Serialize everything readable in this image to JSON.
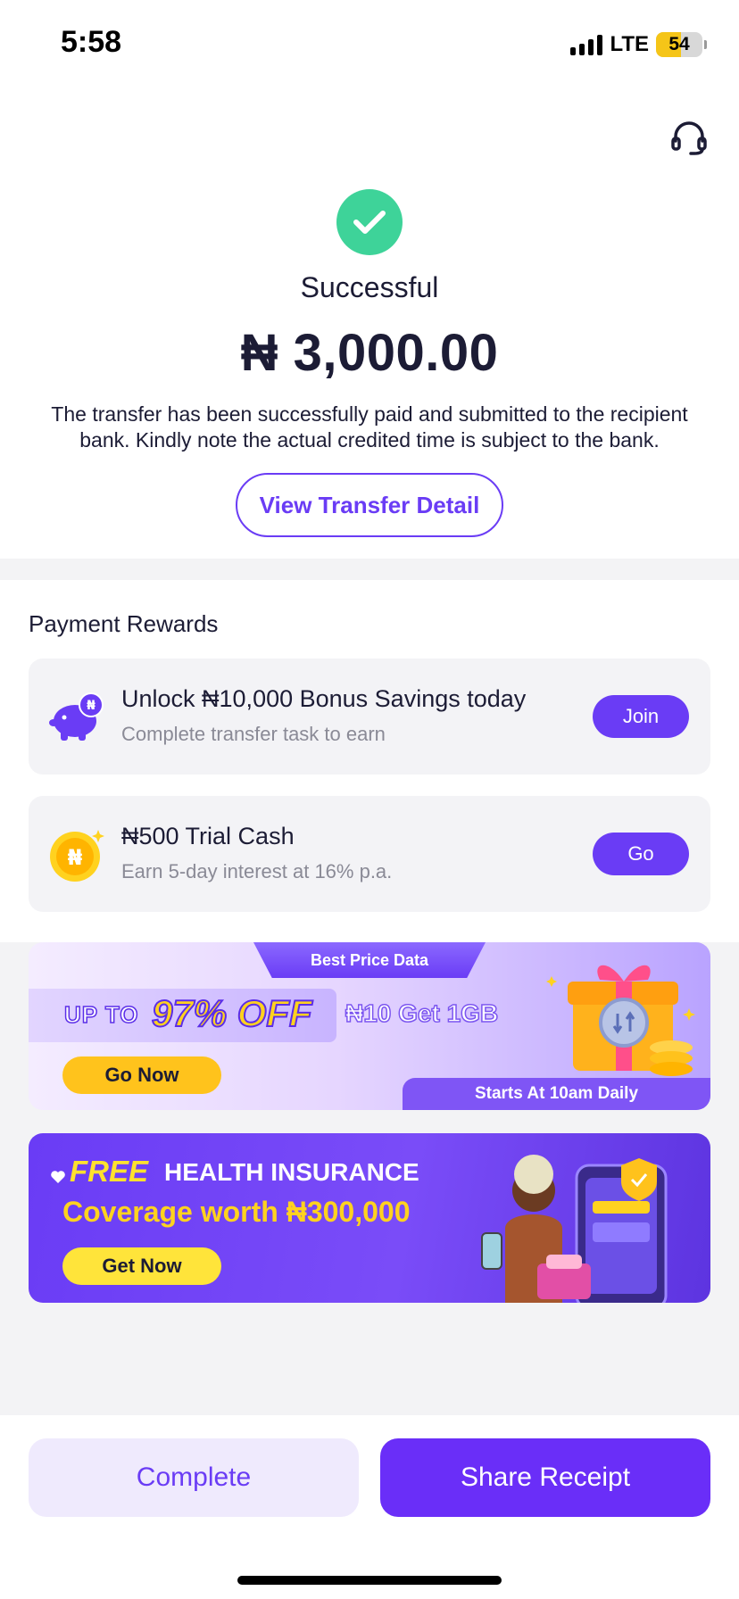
{
  "status_bar": {
    "time": "5:58",
    "network": "LTE",
    "battery": "54",
    "battery_level": 0.54,
    "battery_color": "#f5c518"
  },
  "header": {
    "support_icon": "headset-icon"
  },
  "result": {
    "status_icon": "checkmark-icon",
    "title": "Successful",
    "amount": "₦ 3,000.00",
    "description": "The transfer has been successfully paid and submitted to the recipient bank. Kindly note the actual credited time is subject to the bank.",
    "view_detail_label": "View Transfer Detail"
  },
  "rewards": {
    "title": "Payment Rewards",
    "items": [
      {
        "icon": "piggy-bank-icon",
        "title": "Unlock ₦10,000 Bonus Savings today",
        "subtitle": "Complete transfer task to earn",
        "button": "Join"
      },
      {
        "icon": "naira-coin-icon",
        "title": "₦500 Trial Cash",
        "subtitle": "Earn 5-day interest at 16% p.a.",
        "button": "Go"
      }
    ]
  },
  "banners": {
    "data": {
      "tab": "Best Price Data",
      "up_to": "UP TO",
      "discount": "97% OFF",
      "offer": "₦10 Get 1GB",
      "cta": "Go Now",
      "starts": "Starts At 10am Daily"
    },
    "insurance": {
      "free": "FREE",
      "headline": "HEALTH INSURANCE",
      "coverage": "Coverage worth ₦300,000",
      "cta": "Get Now"
    }
  },
  "actions": {
    "complete": "Complete",
    "share": "Share Receipt"
  },
  "colors": {
    "accent": "#6a3cf5",
    "success": "#3ed399",
    "yellow": "#ffc31c"
  }
}
